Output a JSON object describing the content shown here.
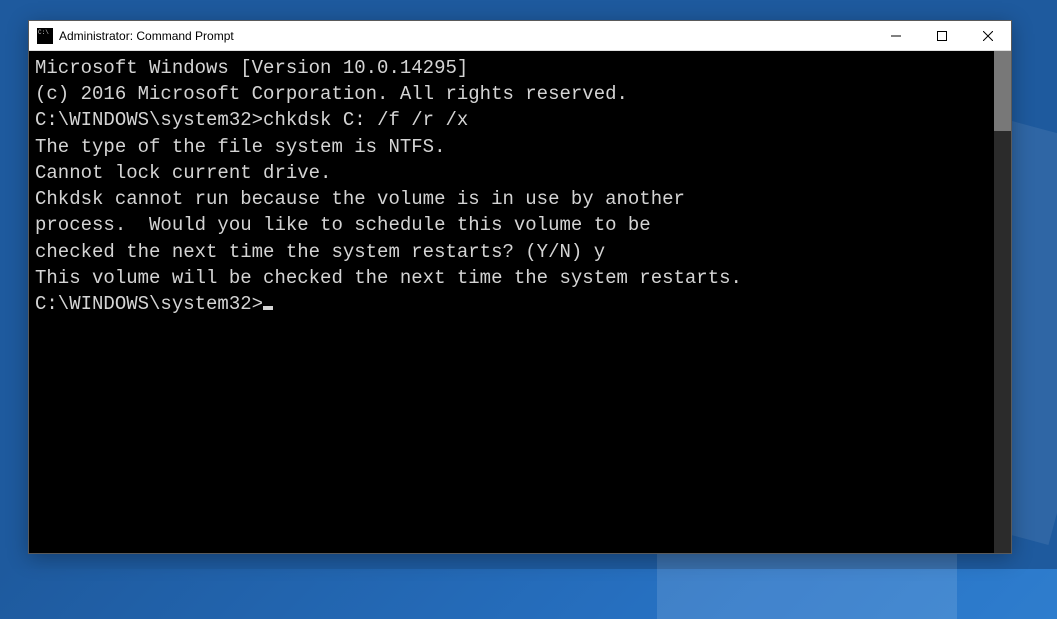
{
  "window": {
    "title": "Administrator: Command Prompt"
  },
  "console": {
    "line1": "Microsoft Windows [Version 10.0.14295]",
    "line2": "(c) 2016 Microsoft Corporation. All rights reserved.",
    "blank1": "",
    "line3_prompt": "C:\\WINDOWS\\system32>",
    "line3_cmd": "chkdsk C: /f /r /x",
    "line4": "The type of the file system is NTFS.",
    "line5": "Cannot lock current drive.",
    "blank2": "",
    "line6": "Chkdsk cannot run because the volume is in use by another",
    "line7": "process.  Would you like to schedule this volume to be",
    "line8": "checked the next time the system restarts? (Y/N) y",
    "blank3": "",
    "line9": "This volume will be checked the next time the system restarts.",
    "blank4": "",
    "line10_prompt": "C:\\WINDOWS\\system32>"
  }
}
